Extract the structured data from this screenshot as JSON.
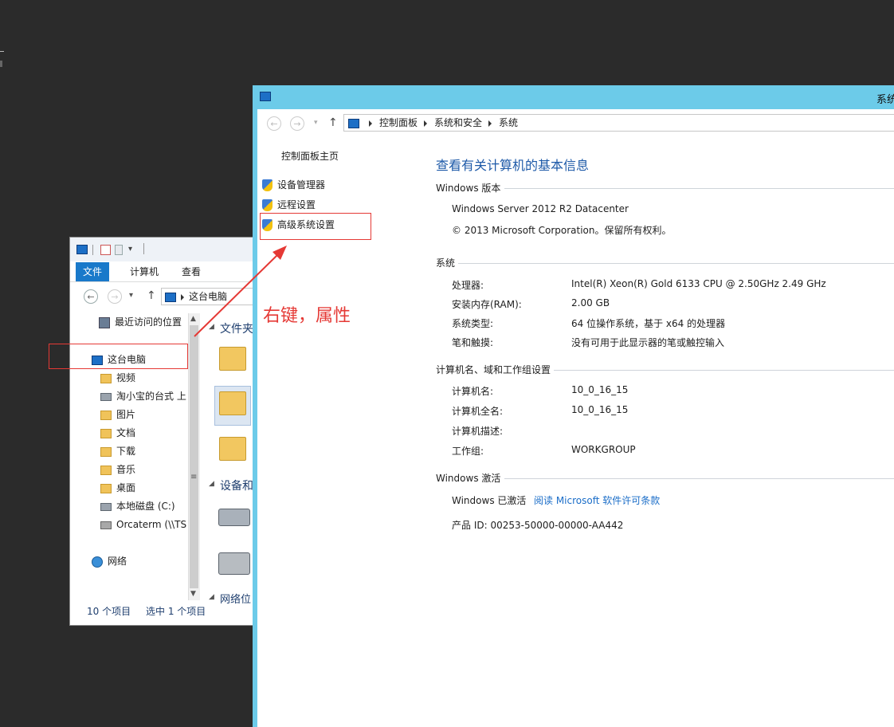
{
  "explorer": {
    "tabs": [
      "文件",
      "计算机",
      "查看"
    ],
    "address": "这台电脑",
    "nav_items": [
      "最近访问的位置",
      "这台电脑",
      "视频",
      "淘小宝的台式 上",
      "图片",
      "文档",
      "下载",
      "音乐",
      "桌面",
      "本地磁盘 (C:)",
      "Orcaterm (\\\\TS",
      "网络"
    ],
    "section_headers": [
      "文件夹",
      "设备和",
      "网络位"
    ],
    "status_count": "10 个项目",
    "status_selected": "选中 1 个项目"
  },
  "system_window": {
    "title": "系统",
    "breadcrumb": [
      "控制面板",
      "系统和安全",
      "系统"
    ],
    "left_nav": {
      "home": "控制面板主页",
      "items": [
        "设备管理器",
        "远程设置",
        "高级系统设置"
      ]
    },
    "heading": "查看有关计算机的基本信息",
    "edition": {
      "section": "Windows 版本",
      "name": "Windows Server 2012 R2 Datacenter",
      "copyright": "© 2013 Microsoft Corporation。保留所有权利。"
    },
    "system": {
      "section": "系统",
      "rows": [
        {
          "label": "处理器:",
          "value": "Intel(R) Xeon(R) Gold 6133 CPU @ 2.50GHz   2.49 GHz"
        },
        {
          "label": "安装内存(RAM):",
          "value": "2.00 GB"
        },
        {
          "label": "系统类型:",
          "value": "64 位操作系统，基于 x64 的处理器"
        },
        {
          "label": "笔和触摸:",
          "value": "没有可用于此显示器的笔或触控输入"
        }
      ]
    },
    "computer": {
      "section": "计算机名、域和工作组设置",
      "rows": [
        {
          "label": "计算机名:",
          "value": "10_0_16_15"
        },
        {
          "label": "计算机全名:",
          "value": "10_0_16_15"
        },
        {
          "label": "计算机描述:",
          "value": ""
        },
        {
          "label": "工作组:",
          "value": "WORKGROUP"
        }
      ]
    },
    "activation": {
      "section": "Windows 激活",
      "status": "Windows 已激活",
      "license_link": "阅读 Microsoft 软件许可条款",
      "product_id": "产品 ID: 00253-50000-00000-AA442"
    }
  },
  "annotation": {
    "text": "右键，属性",
    "color": "#e53935"
  }
}
